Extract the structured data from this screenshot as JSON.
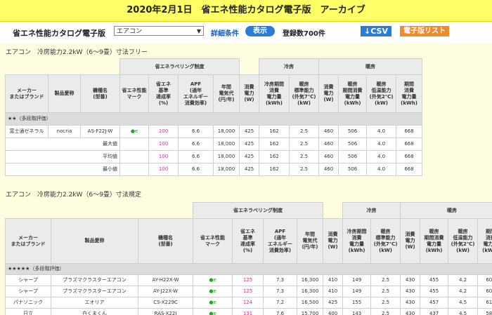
{
  "page_title": "2020年2月1日　省エネ性能カタログ電子版　アーカイブ",
  "toolbar": {
    "catalog_label": "省エネ性能カタログ電子版",
    "category_selected": "エアコン",
    "detail_link": "詳細条件",
    "show_button": "表示",
    "count_text": "登録数700件",
    "csv_button": "↓CSV",
    "list_button": "電子版リスト"
  },
  "headers": {
    "group_label": "省エネラベリング制度",
    "cooling": "冷房",
    "heating": "暖房",
    "maker": [
      "メーカー",
      "またはブランド"
    ],
    "product_name": "製品愛称",
    "model": [
      "機種名",
      "(型番)"
    ],
    "mark": [
      "省エネ性能",
      "マーク"
    ],
    "rate": [
      "省エネ",
      "基準",
      "達成率",
      "(%)"
    ],
    "apf": [
      "APF",
      "(通年",
      "エネルギー",
      "消費効率)"
    ],
    "annual_cost": [
      "年間",
      "電気代",
      "(円/年)"
    ],
    "cool_power": [
      "消費",
      "電力",
      "(W)"
    ],
    "cool_period": [
      "冷房期間",
      "消費",
      "電力量",
      "(kWh)"
    ],
    "heat_capacity": [
      "暖房",
      "標準能力",
      "(外気7℃)",
      "(kW)"
    ],
    "heat_power": [
      "消費",
      "電力",
      "(W)"
    ],
    "heat_period": [
      "暖房",
      "期間消費",
      "電力量",
      "(kWh)"
    ],
    "heat_low": [
      "暖房",
      "低温能力",
      "(外気2℃)",
      "(kW)"
    ],
    "period_total": [
      "期間",
      "消費",
      "電力量",
      "(kWh)"
    ]
  },
  "section1": {
    "title": "エアコン　冷房能力2.2kW（6～9畳）寸法フリー",
    "category": "★★（多段階評価）",
    "rows": [
      {
        "maker": "富士通ゼネラル",
        "name": "nocria",
        "model": "AS-F22J-W",
        "mark": "●e",
        "rate": "100",
        "apf": "6.6",
        "cost": "18,000",
        "cool_w": "425",
        "cool_kwh": "162",
        "heat_cap": "2.5",
        "heat_w": "460",
        "heat_kwh": "506",
        "low_cap": "4.0",
        "total": "668"
      }
    ],
    "stats": [
      {
        "label": "最大値",
        "rate": "100",
        "apf": "6.6",
        "cost": "18,000",
        "cool_w": "425",
        "cool_kwh": "162",
        "heat_cap": "2.5",
        "heat_w": "460",
        "heat_kwh": "506",
        "low_cap": "4.0",
        "total": "668"
      },
      {
        "label": "平均値",
        "rate": "100",
        "apf": "6.6",
        "cost": "18,000",
        "cool_w": "425",
        "cool_kwh": "162",
        "heat_cap": "2.5",
        "heat_w": "460",
        "heat_kwh": "506",
        "low_cap": "4.0",
        "total": "668"
      },
      {
        "label": "最小値",
        "rate": "100",
        "apf": "6.6",
        "cost": "18,000",
        "cool_w": "425",
        "cool_kwh": "162",
        "heat_cap": "2.5",
        "heat_w": "460",
        "heat_kwh": "506",
        "low_cap": "4.0",
        "total": "668"
      }
    ]
  },
  "section2": {
    "title": "エアコン　冷房能力2.2kW（6～9畳）寸法規定",
    "category": "★★★★★（多段階評価）",
    "rows": [
      {
        "maker": "シャープ",
        "name": "プラズマクラスターエアコン",
        "model": "AY-H22X-W",
        "mark": "●e",
        "rate": "125",
        "apf": "7.3",
        "cost": "16,300",
        "cool_w": "410",
        "cool_kwh": "149",
        "heat_cap": "2.5",
        "heat_w": "430",
        "heat_kwh": "455",
        "low_cap": "4.2",
        "total": "604"
      },
      {
        "maker": "シャープ",
        "name": "プラズマクラスターエアコン",
        "model": "AY-J22X-W",
        "mark": "●e",
        "rate": "125",
        "apf": "7.3",
        "cost": "16,300",
        "cool_w": "410",
        "cool_kwh": "149",
        "heat_cap": "2.5",
        "heat_w": "430",
        "heat_kwh": "455",
        "low_cap": "4.2",
        "total": "604"
      },
      {
        "maker": "パナソニック",
        "name": "エオリア",
        "model": "CS-X229C",
        "mark": "●e",
        "rate": "124",
        "apf": "7.2",
        "cost": "16,500",
        "cool_w": "425",
        "cool_kwh": "155",
        "heat_cap": "2.5",
        "heat_w": "430",
        "heat_kwh": "457",
        "low_cap": "4.5",
        "total": "612"
      },
      {
        "maker": "日立",
        "name": "白くまくん",
        "model": "RAS-X22J",
        "mark": "●e",
        "rate": "131",
        "apf": "7.6",
        "cost": "15,700",
        "cool_w": "400",
        "cool_kwh": "143",
        "heat_cap": "2.5",
        "heat_w": "430",
        "heat_kwh": "437",
        "low_cap": "4.5",
        "total": "580"
      }
    ]
  }
}
